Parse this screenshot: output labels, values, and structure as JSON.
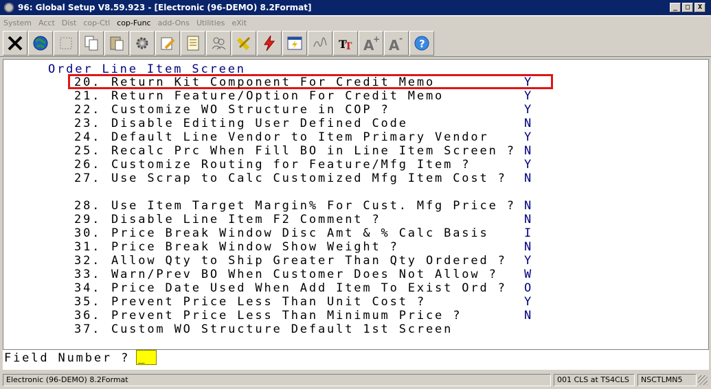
{
  "window": {
    "title": "96: Global Setup V8.59.923 - [Electronic (96-DEMO) 8.2Format]",
    "buttons": [
      "_",
      "□",
      "X"
    ]
  },
  "menu": [
    "System",
    "Acct",
    "Dist",
    "cop-Ctl",
    "cop-Func",
    "add-Ons",
    "Utilities",
    "eXit"
  ],
  "toolbar": {
    "icons": [
      "exit-icon",
      "globe-icon",
      "blank-icon",
      "copy-icon",
      "paste-icon",
      "settings-icon",
      "edit-icon",
      "list-icon",
      "users-icon",
      "tools-icon",
      "flash-icon",
      "launch-icon",
      "signature-icon",
      "font-size-icon",
      "font-increase-icon",
      "font-decrease-icon",
      "help-icon"
    ]
  },
  "screen": {
    "title": "Order Line Item Screen",
    "lines": [
      {
        "num": "20.",
        "label": "Return Kit Component For Credit Memo",
        "value": "Y"
      },
      {
        "num": "21.",
        "label": "Return Feature/Option For Credit Memo",
        "value": "Y"
      },
      {
        "num": "22.",
        "label": "Customize WO Structure in COP ?",
        "value": "Y"
      },
      {
        "num": "23.",
        "label": "Disable Editing User Defined Code",
        "value": "N"
      },
      {
        "num": "24.",
        "label": "Default Line Vendor to Item Primary Vendor",
        "value": "Y"
      },
      {
        "num": "25.",
        "label": "Recalc Prc When Fill BO in Line Item Screen ?",
        "value": "N"
      },
      {
        "num": "26.",
        "label": "Customize Routing for Feature/Mfg Item ?",
        "value": "Y"
      },
      {
        "num": "27.",
        "label": "Use Scrap to Calc Customized Mfg Item Cost ?",
        "value": "N"
      },
      {
        "num": "28.",
        "label": "Use Item Target Margin% For Cust. Mfg Price ?",
        "value": "N"
      },
      {
        "num": "29.",
        "label": "Disable Line Item F2 Comment ?",
        "value": "N"
      },
      {
        "num": "30.",
        "label": "Price Break Window Disc Amt & % Calc Basis",
        "value": "I"
      },
      {
        "num": "31.",
        "label": "Price Break Window Show Weight ?",
        "value": "N"
      },
      {
        "num": "32.",
        "label": "Allow Qty to Ship Greater Than Qty Ordered ?",
        "value": "Y"
      },
      {
        "num": "33.",
        "label": "Warn/Prev BO When Customer Does Not Allow ?",
        "value": "W"
      },
      {
        "num": "34.",
        "label": "Price Date Used When Add Item To Exist Ord ?",
        "value": "O"
      },
      {
        "num": "35.",
        "label": "Prevent Price Less Than Unit Cost ?",
        "value": "Y"
      },
      {
        "num": "36.",
        "label": "Prevent Price Less Than Minimum Price ?",
        "value": "N"
      },
      {
        "num": "37.",
        "label": "Custom WO Structure Default 1st Screen",
        "value": ""
      }
    ]
  },
  "prompt": {
    "label": "Field Number ?",
    "value": "_"
  },
  "status": {
    "left": "Electronic (96-DEMO) 8.2Format",
    "middle": "001 CLS at TS4CLS",
    "right": "NSCTLMN5"
  },
  "colors": {
    "titlebar": "#0a246a",
    "highlight_box": "#e01515",
    "value_text": "#00007f",
    "prompt_input": "#ffff00"
  }
}
